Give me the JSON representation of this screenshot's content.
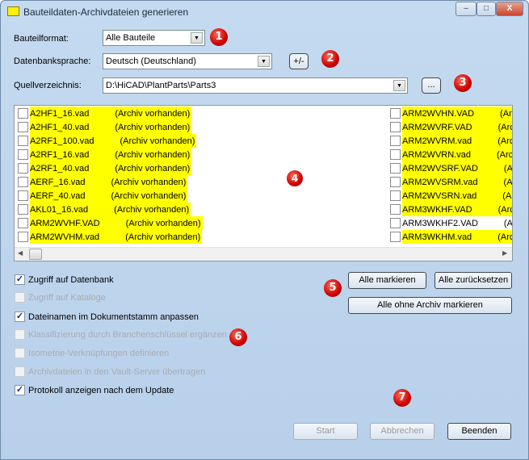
{
  "window": {
    "title": "Bauteildaten-Archivdateien generieren",
    "minimize": "–",
    "maximize": "□",
    "close": "X"
  },
  "form": {
    "bauteilformat_label": "Bauteilformat:",
    "bauteilformat_value": "Alle Bauteile",
    "sprache_label": "Datenbanksprache:",
    "sprache_value": "Deutsch (Deutschland)",
    "plusminus_label": "+/-",
    "quelle_label": "Quellverzeichnis:",
    "quelle_value": "D:\\HiCAD\\PlantParts\\Parts3",
    "browse_label": "..."
  },
  "markers": [
    "1",
    "2",
    "3",
    "4",
    "5",
    "6",
    "7"
  ],
  "list": {
    "left": [
      {
        "name": "A2HF1_16.vad",
        "status": "(Archiv vorhanden)",
        "highlighted": true,
        "checked": false
      },
      {
        "name": "A2HF1_40.vad",
        "status": "(Archiv vorhanden)",
        "highlighted": true,
        "checked": false
      },
      {
        "name": "A2RF1_100.vad",
        "status": "(Archiv vorhanden)",
        "highlighted": true,
        "checked": false
      },
      {
        "name": "A2RF1_16.vad",
        "status": "(Archiv vorhanden)",
        "highlighted": true,
        "checked": false
      },
      {
        "name": "A2RF1_40.vad",
        "status": "(Archiv vorhanden)",
        "highlighted": true,
        "checked": false
      },
      {
        "name": "AERF_16.vad",
        "status": "(Archiv vorhanden)",
        "highlighted": true,
        "checked": false
      },
      {
        "name": "AERF_40.vad",
        "status": "(Archiv vorhanden)",
        "highlighted": true,
        "checked": false
      },
      {
        "name": "AKL01_16.vad",
        "status": "(Archiv vorhanden)",
        "highlighted": true,
        "checked": false
      },
      {
        "name": "ARM2WVHF.VAD",
        "status": "(Archiv vorhanden)",
        "highlighted": true,
        "checked": false
      },
      {
        "name": "ARM2WVHM.vad",
        "status": "(Archiv vorhanden)",
        "highlighted": true,
        "checked": false
      }
    ],
    "right": [
      {
        "name": "ARM2WVHN.VAD",
        "status": "(Archiv",
        "highlighted": true,
        "checked": false
      },
      {
        "name": "ARM2WVRF.VAD",
        "status": "(Archiv",
        "highlighted": true,
        "checked": false
      },
      {
        "name": "ARM2WVRM.vad",
        "status": "(Archiv",
        "highlighted": true,
        "checked": false
      },
      {
        "name": "ARM2WVRN.vad",
        "status": "(Archiv",
        "highlighted": true,
        "checked": false
      },
      {
        "name": "ARM2WVSRF.VAD",
        "status": "(Arch",
        "highlighted": true,
        "checked": false
      },
      {
        "name": "ARM2WVSRM.vad",
        "status": "(Arch",
        "highlighted": true,
        "checked": false
      },
      {
        "name": "ARM2WVSRN.vad",
        "status": "(Arch",
        "highlighted": true,
        "checked": false
      },
      {
        "name": "ARM3WKHF.VAD",
        "status": "(Archiv",
        "highlighted": true,
        "checked": false
      },
      {
        "name": "ARM3WKHF2.VAD",
        "status": "(Arch",
        "highlighted": false,
        "checked": false
      },
      {
        "name": "ARM3WKHM.vad",
        "status": "(Archiv",
        "highlighted": true,
        "checked": false
      }
    ],
    "highlight_color": "#ffff00"
  },
  "options": [
    {
      "label": "Zugriff auf Datenbank",
      "checked": true,
      "enabled": true
    },
    {
      "label": "Zugriff auf Kataloge",
      "checked": false,
      "enabled": false
    },
    {
      "label": "Dateinamen im Dokumentstamm anpassen",
      "checked": true,
      "enabled": true
    },
    {
      "label": "Klassifizierung durch Branchenschlüssel ergänzen",
      "checked": false,
      "enabled": false
    },
    {
      "label": "Isometrie-Verknüpfungen definieren",
      "checked": false,
      "enabled": false
    },
    {
      "label": "Archivdateien in den Vault-Server übertragen",
      "checked": false,
      "enabled": false
    },
    {
      "label": "Protokoll anzeigen nach dem Update",
      "checked": true,
      "enabled": true
    }
  ],
  "buttons": {
    "mark_all": "Alle markieren",
    "reset_all": "Alle zurücksetzen",
    "mark_no_archive": "Alle ohne Archiv markieren",
    "start": "Start",
    "cancel": "Abbrechen",
    "close": "Beenden"
  }
}
